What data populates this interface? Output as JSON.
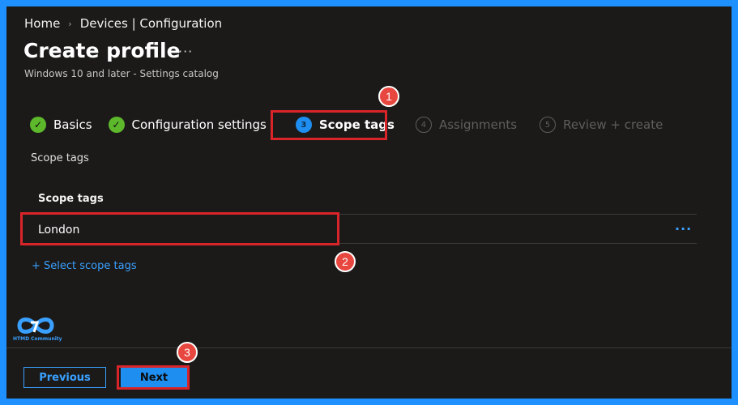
{
  "breadcrumb": {
    "home": "Home",
    "separator": "›",
    "current": "Devices | Configuration"
  },
  "page": {
    "title": "Create profile",
    "more": "···",
    "subtitle": "Windows 10 and later - Settings catalog"
  },
  "steps": [
    {
      "label": "Basics",
      "state": "done",
      "icon": "✓"
    },
    {
      "label": "Configuration settings",
      "state": "done",
      "icon": "✓"
    },
    {
      "label": "Scope tags",
      "state": "active",
      "icon": "3"
    },
    {
      "label": "Assignments",
      "state": "disabled",
      "icon": "4"
    },
    {
      "label": "Review + create",
      "state": "disabled",
      "icon": "5"
    }
  ],
  "scope": {
    "section_label": "Scope tags",
    "table_header": "Scope tags",
    "rows": [
      {
        "name": "London",
        "more": "···"
      }
    ],
    "select_link": "+ Select scope tags"
  },
  "logo": {
    "text": "HTMD Community"
  },
  "footer": {
    "previous": "Previous",
    "next": "Next"
  },
  "annotations": {
    "marker1": "1",
    "marker2": "2",
    "marker3": "3"
  },
  "colors": {
    "accent": "#1f8ef1",
    "link": "#3aa0ff",
    "success": "#5db82b",
    "highlight": "#d9252a",
    "background": "#1b1a19",
    "outer": "#1e90ff"
  }
}
